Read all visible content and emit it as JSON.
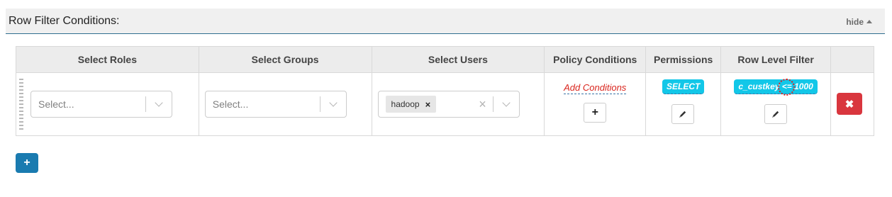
{
  "panel": {
    "title": "Row Filter Conditions:",
    "hide_label": "hide",
    "accent_color": "#2f6f8f"
  },
  "table": {
    "headers": [
      "Select Roles",
      "Select Groups",
      "Select Users",
      "Policy Conditions",
      "Permissions",
      "Row Level Filter",
      ""
    ],
    "row": {
      "roles": {
        "placeholder": "Select..."
      },
      "groups": {
        "placeholder": "Select..."
      },
      "users": {
        "tags": [
          "hadoop"
        ],
        "remove_glyph": "×",
        "clear_glyph": "×"
      },
      "policy_conditions": {
        "link_label": "Add Conditions",
        "add_glyph": "+"
      },
      "permissions": {
        "badge": "SELECT",
        "edit_icon": "pencil-icon"
      },
      "row_level_filter": {
        "badge": "c_custkey <= 1000",
        "edit_icon": "pencil-icon"
      },
      "delete_glyph": "✖"
    }
  },
  "add_row_glyph": "+",
  "colors": {
    "badge": "#12c7e8",
    "delete": "#d9363e",
    "add_button": "#1a7bb0",
    "link": "#d9241c"
  }
}
